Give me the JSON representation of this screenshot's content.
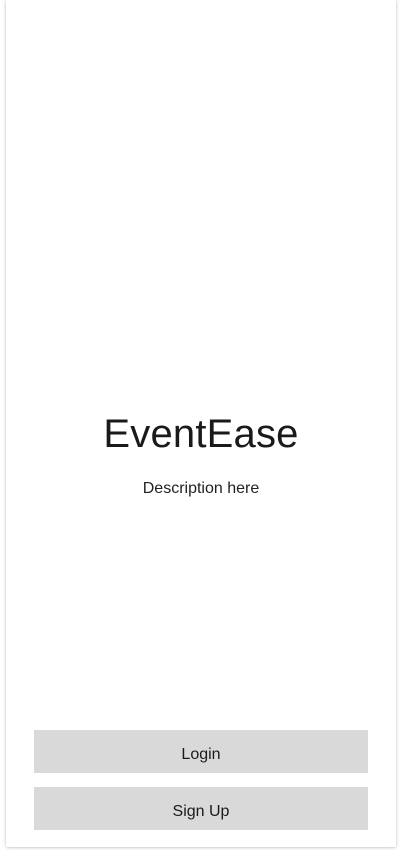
{
  "app": {
    "title": "EventEase",
    "description": "Description here"
  },
  "actions": {
    "login_label": "Login",
    "signup_label": "Sign Up"
  },
  "colors": {
    "background": "#ffffff",
    "button_background": "#d9d9d9",
    "text": "#1a1a1a"
  }
}
